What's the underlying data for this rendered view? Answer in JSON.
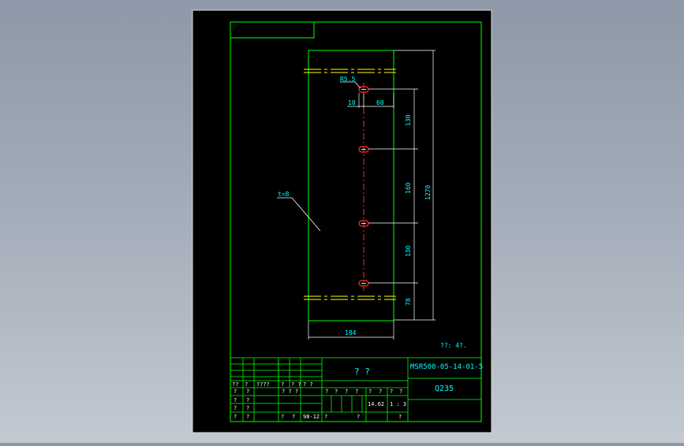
{
  "drawing": {
    "part_number": "MSR500-05-14-01-5",
    "part_name": "? ?",
    "material": "Q235",
    "sheet_note": "??: 4?.",
    "thickness_label": "t=8",
    "hole_label": "R5.5",
    "dims": {
      "left_offset": "10",
      "hole_to_edge": "60",
      "spacing_top": "130",
      "spacing_mid": "160",
      "spacing_bottom": "130",
      "bottom_offset": "78",
      "total_height": "1270",
      "width": "184"
    },
    "title_block": {
      "header_row": [
        "??",
        "?",
        "????",
        "?",
        "? ?",
        "? ?"
      ],
      "row_a": [
        "?",
        "?",
        "",
        "? ? ?",
        "",
        ""
      ],
      "row_b": [
        "?",
        "?"
      ],
      "row_c": [
        "?",
        "?"
      ],
      "row_d": [
        "?",
        "?",
        "?",
        "?",
        "98-12"
      ],
      "mid_labels": [
        "?",
        "?",
        "?",
        "?",
        "?",
        "?",
        "?",
        "?"
      ],
      "weight": "14.62",
      "scale": "1 : 3",
      "mid_bottom": [
        "?",
        "?",
        "?"
      ]
    }
  },
  "colors": {
    "frame": "#00ff00",
    "dimension": "#00ffff",
    "background": "#000000",
    "hole": "#ff2a2a",
    "yellow": "#ffff00",
    "white": "#ffffff"
  }
}
